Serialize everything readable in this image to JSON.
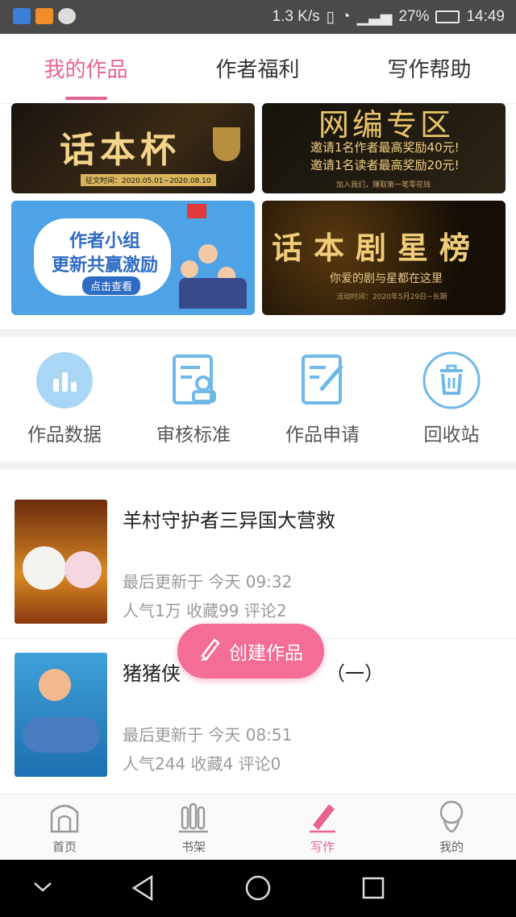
{
  "status_bar": {
    "net_speed": "1.3 K/s",
    "battery": "27%",
    "time": "14:49"
  },
  "tabs": [
    {
      "label": "我的作品",
      "active": true
    },
    {
      "label": "作者福利",
      "active": false
    },
    {
      "label": "写作帮助",
      "active": false
    }
  ],
  "banners": [
    {
      "title": "话本杯",
      "subtitle": "征文时间：2020.05.01~2020.08.10"
    },
    {
      "title": "网编专区",
      "line1": "邀请1名作者最高奖励40元!",
      "line2": "邀请1名读者最高奖励20元!",
      "footer": "加入我们，赚取第一笔零花钱"
    },
    {
      "title": "作者小组",
      "line2": "更新共赢激励",
      "button": "点击查看"
    },
    {
      "title": "话本剧星榜",
      "subtitle": "你爱的剧与星都在这里",
      "footer": "活动时间：2020年5月29日~长期"
    }
  ],
  "quick_actions": [
    {
      "label": "作品数据",
      "icon": "bar-chart-icon"
    },
    {
      "label": "审核标准",
      "icon": "review-icon"
    },
    {
      "label": "作品申请",
      "icon": "edit-document-icon"
    },
    {
      "label": "回收站",
      "icon": "trash-icon"
    }
  ],
  "works": [
    {
      "title": "羊村守护者三异国大营救",
      "updated": "最后更新于 今天 09:32",
      "stats": "人气1万  收藏99  评论2"
    },
    {
      "title": "猪猪侠",
      "title_tail": "（一）",
      "updated": "最后更新于 今天 08:51",
      "stats": "人气244  收藏4  评论0"
    }
  ],
  "fab": {
    "label": "创建作品",
    "icon": "pencil-icon"
  },
  "bottom_nav": [
    {
      "label": "首页",
      "icon": "home-icon",
      "active": false
    },
    {
      "label": "书架",
      "icon": "bookshelf-icon",
      "active": false
    },
    {
      "label": "写作",
      "icon": "write-icon",
      "active": true
    },
    {
      "label": "我的",
      "icon": "profile-icon",
      "active": false
    }
  ],
  "colors": {
    "accent": "#e8648f",
    "fab": "#f36d96",
    "icon_blue": "#6fb8e8"
  }
}
